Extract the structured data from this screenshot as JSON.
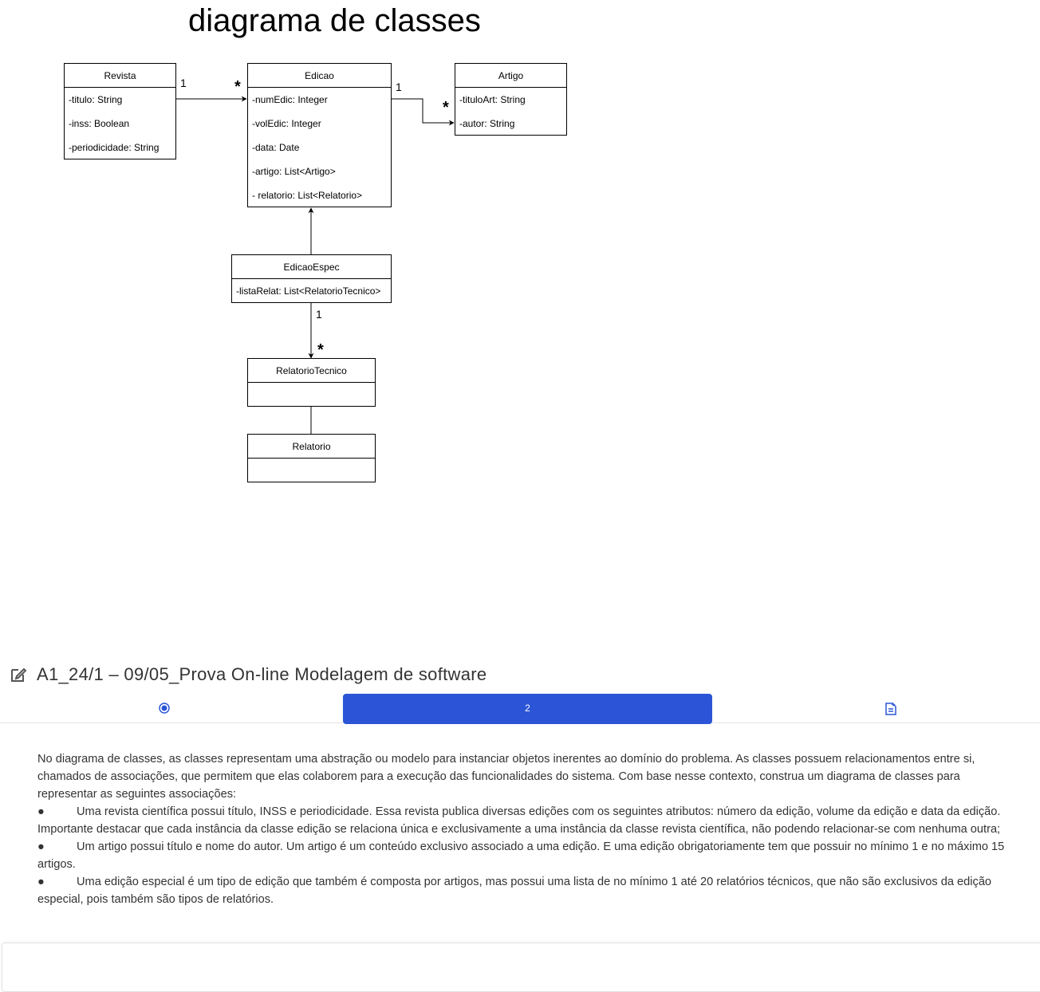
{
  "diagram": {
    "title": "diagrama de classes",
    "classes": {
      "revista": {
        "name": "Revista",
        "attrs": [
          "-titulo: String",
          "-inss: Boolean",
          "-periodicidade: String"
        ]
      },
      "edicao": {
        "name": "Edicao",
        "attrs": [
          "-numEdic: Integer",
          "-volEdic: Integer",
          "-data: Date",
          "-artigo: List<Artigo>",
          "- relatorio: List<Relatorio>"
        ]
      },
      "artigo": {
        "name": "Artigo",
        "attrs": [
          "-tituloArt: String",
          "-autor: String"
        ]
      },
      "edicaoespec": {
        "name": "EdicaoEspec",
        "attrs": [
          "-listaRelat: List<RelatorioTecnico>"
        ]
      },
      "relatoriotecnico": {
        "name": "RelatorioTecnico",
        "attrs": []
      },
      "relatorio": {
        "name": "Relatorio",
        "attrs": []
      }
    },
    "multiplicities": {
      "revista_edicao_one": "1",
      "revista_edicao_many": "*",
      "edicao_artigo_one": "1",
      "edicao_artigo_many": "*",
      "espec_relat_one": "1",
      "espec_relat_many": "*"
    }
  },
  "exam": {
    "title": "A1_24/1 – 09/05_Prova On-line Modelagem de software",
    "nav": {
      "current_question": "2"
    },
    "icons": {
      "header": "edit-icon",
      "radio": "radio-selected-icon",
      "review": "review-document-icon"
    },
    "accent_color": "#2b55d6"
  },
  "question": {
    "intro": "No diagrama de classes, as classes representam uma abstração ou modelo para instanciar objetos inerentes ao domínio do problema. As classes possuem relacionamentos entre si, chamados de associações, que permitem que elas colaborem para a execução das funcionalidades do sistema. Com base nesse contexto, construa um diagrama de classes para representar as seguintes associações:",
    "bullet_symbol": "●",
    "items": [
      "Uma revista científica possui título, INSS e periodicidade. Essa revista publica diversas edições com os seguintes atributos: número da edição, volume da edição e data da edição. Importante destacar que cada instância da classe edição se relaciona única e exclusivamente a uma instância da classe revista científica, não podendo relacionar-se com nenhuma outra;",
      "Um artigo possui título e nome do autor. Um artigo é um conteúdo exclusivo associado a uma edição. E uma edição obrigatoriamente tem que possuir no mínimo 1 e no máximo 15 artigos.",
      "Uma edição especial é um tipo de edição que também é composta por artigos, mas possui uma lista de no mínimo 1 até 20 relatórios técnicos, que não são exclusivos da edição especial, pois também são tipos de relatórios."
    ]
  }
}
